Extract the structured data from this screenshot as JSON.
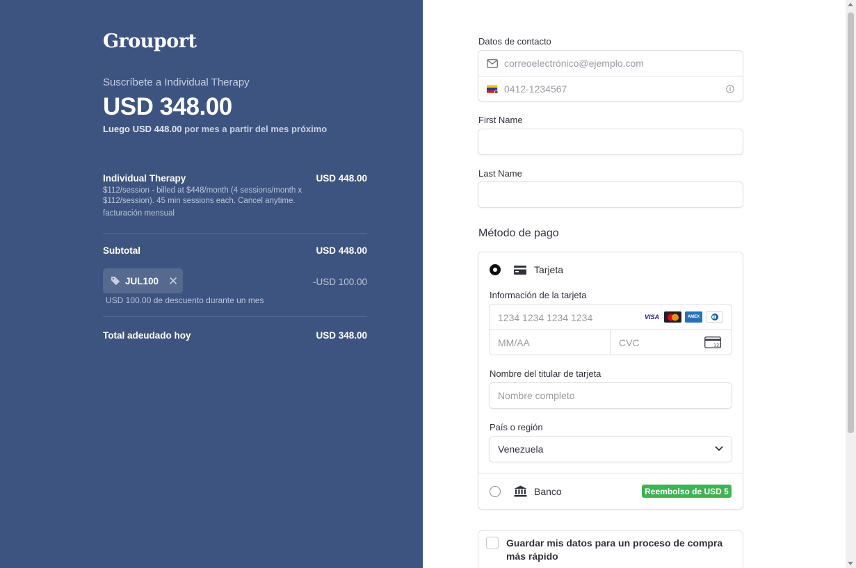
{
  "brand": {
    "name": "Grouport"
  },
  "summary": {
    "subscribe_label": "Suscríbete a Individual Therapy",
    "price": "USD 348.00",
    "then_amount": "Luego USD 448.00",
    "then_suffix": "por mes a partir del mes próximo"
  },
  "line_item": {
    "name": "Individual Therapy",
    "price": "USD 448.00",
    "description": "$112/session - billed at $448/month (4 sessions/month x $112/session). 45 min sessions each. Cancel anytime.",
    "billing": "facturación mensual"
  },
  "subtotal": {
    "label": "Subtotal",
    "value": "USD 448.00"
  },
  "promo": {
    "code": "JUL100",
    "discount": "-USD 100.00",
    "note": "USD 100.00 de descuento durante un mes"
  },
  "total": {
    "label": "Total adeudado hoy",
    "value": "USD 348.00"
  },
  "contact": {
    "title": "Datos de contacto",
    "email_placeholder": "correoelectrónico@ejemplo.com",
    "phone_placeholder": "0412-1234567"
  },
  "first_name": {
    "label": "First Name",
    "value": ""
  },
  "last_name": {
    "label": "Last Name",
    "value": ""
  },
  "payment": {
    "title": "Método de pago",
    "card_label": "Tarjeta",
    "card_info_label": "Información de la tarjeta",
    "card_number_placeholder": "1234 1234 1234 1234",
    "expiry_placeholder": "MM/AA",
    "cvc_placeholder": "CVC",
    "brand_visa": "VISA",
    "brand_amex": "AMEX",
    "holder_label": "Nombre del titular de tarjeta",
    "holder_placeholder": "Nombre completo",
    "country_label": "País o región",
    "country_value": "Venezuela",
    "bank_label": "Banco",
    "bank_rebate": "Reembolso de USD 5"
  },
  "save_info": {
    "label": "Guardar mis datos para un proceso de compra más rápido"
  },
  "colors": {
    "left_bg": "#3e5480",
    "rebate_green": "#3eb356"
  }
}
